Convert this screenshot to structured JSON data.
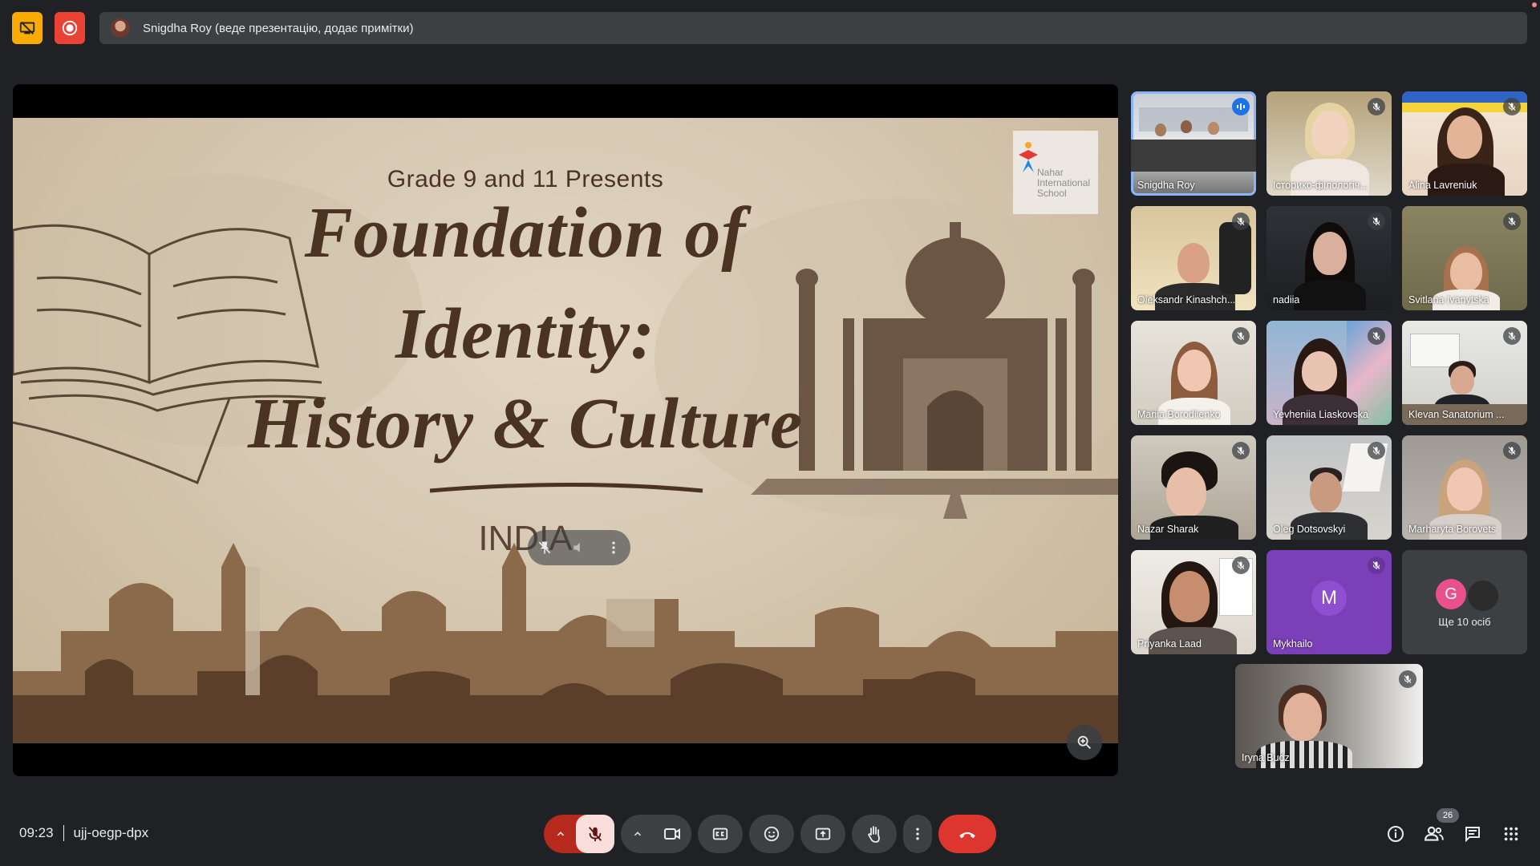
{
  "topbar": {
    "presenter_label": "Snigdha Roy (веде презентацію, додає примітки)"
  },
  "slide": {
    "subtitle": "Grade 9 and 11 Presents",
    "title_line1": "Foundation of",
    "title_line2": "Identity:",
    "title_line3": "History & Culture",
    "country": "INDIA",
    "logo_text": "Nahar International School"
  },
  "participants": [
    {
      "name": "Snigdha Roy",
      "status": "speaking"
    },
    {
      "name": "Історико-філологіч...",
      "status": "muted"
    },
    {
      "name": "Alina Lavreniuk",
      "status": "muted"
    },
    {
      "name": "Oleksandr Kinashch...",
      "status": "muted"
    },
    {
      "name": "nadiia",
      "status": "muted"
    },
    {
      "name": "Svitlana Ivanytska",
      "status": "muted"
    },
    {
      "name": "Mariia Borodiienko",
      "status": "muted"
    },
    {
      "name": "Yevheniia Liaskovska",
      "status": "muted"
    },
    {
      "name": "Klevan Sanatorium ...",
      "status": "muted"
    },
    {
      "name": "Nazar Sharak",
      "status": "muted"
    },
    {
      "name": "Oleg Dotsovskyi",
      "status": "muted"
    },
    {
      "name": "Marharyta Borovets",
      "status": "muted"
    },
    {
      "name": "Priyanka Laad",
      "status": "muted"
    },
    {
      "name": "Mykhailo",
      "status": "muted",
      "avatar_letter": "M"
    },
    {
      "name": "Iryna Budz",
      "status": "muted"
    }
  ],
  "more_tile": {
    "avatar_letter": "G",
    "label": "Ще 10 осіб"
  },
  "bottombar": {
    "time": "09:23",
    "meeting_code": "ujj-oegp-dpx",
    "people_count": "26"
  },
  "colors": {
    "background": "#202124",
    "present_button": "#f9ab00",
    "record_button": "#ea4335",
    "hangup": "#dc362e",
    "active_speaker_outline": "#8ab4f8",
    "slide_text": "#4b3324"
  },
  "icons": [
    "present-stop-icon",
    "record-icon",
    "mic-off-icon",
    "camera-icon",
    "captions-icon",
    "emoji-icon",
    "present-icon",
    "raise-hand-icon",
    "more-vert-icon",
    "hang-up-icon",
    "info-icon",
    "people-icon",
    "chat-icon",
    "activities-icon",
    "zoom-in-icon"
  ]
}
